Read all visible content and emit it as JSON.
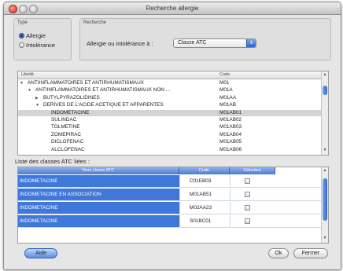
{
  "window": {
    "title": "Recherche allergie"
  },
  "type_group": {
    "label": "Type",
    "options": [
      {
        "label": "Allergie",
        "selected": true
      },
      {
        "label": "Intolérance",
        "selected": false
      }
    ]
  },
  "search_group": {
    "label": "Recherche",
    "field_label": "Allergie ou intolérance à :",
    "select_value": "Classe ATC"
  },
  "tree": {
    "columns": {
      "libelle": "Libellé",
      "code": "Code"
    },
    "rows": [
      {
        "label": "ANTIINFLAMMATOIRES ET ANTIRHUMATISMAUX",
        "code": "M01",
        "toggle": "▼",
        "depth": 0
      },
      {
        "label": "ANTIINFLAMMATOIRES ET ANTIRHUMATISMAUX NON ...",
        "code": "M01A",
        "toggle": "▼",
        "depth": 1
      },
      {
        "label": "BUTYLPYRAZOLIDINES",
        "code": "M01AA",
        "toggle": "▶",
        "depth": 2
      },
      {
        "label": "DERIVES DE L'ACIDE ACETIQUE ET APPARENTES",
        "code": "M01AB",
        "toggle": "▼",
        "depth": 2
      },
      {
        "label": "INDOMETACINE",
        "code": "M01AB01",
        "toggle": "",
        "depth": 3,
        "selected": true
      },
      {
        "label": "SULINDAC",
        "code": "M01AB02",
        "toggle": "",
        "depth": 3
      },
      {
        "label": "TOLMETINE",
        "code": "M01AB03",
        "toggle": "",
        "depth": 3
      },
      {
        "label": "ZOMEPIRAC",
        "code": "M01AB04",
        "toggle": "",
        "depth": 3
      },
      {
        "label": "DICLOFENAC",
        "code": "M01AB05",
        "toggle": "",
        "depth": 3
      },
      {
        "label": "ALCLOFENAC",
        "code": "M01AB06",
        "toggle": "",
        "depth": 3
      }
    ]
  },
  "linked": {
    "label": "Liste des classes ATC liées :",
    "columns": {
      "name": "Nom classe ATC",
      "code": "Code",
      "selection": "Sélection"
    },
    "rows": [
      {
        "name": "INDOMETACINE",
        "code": "C01EB03"
      },
      {
        "name": "INDOMETACINE EN ASSOCIATION",
        "code": "M01AB51"
      },
      {
        "name": "INDOMETACINE",
        "code": "M02AA23"
      },
      {
        "name": "INDOMETACINE",
        "code": "S01BC01"
      }
    ]
  },
  "buttons": {
    "help": "Aide",
    "ok": "Ok",
    "cancel": "Fermer"
  },
  "colors": {
    "selection_blue": "#3f78d8",
    "header_blue": "#4a7bd6"
  }
}
